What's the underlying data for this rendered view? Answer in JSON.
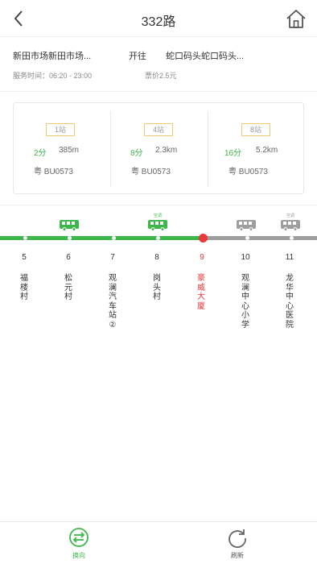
{
  "header": {
    "title": "332路"
  },
  "route": {
    "from": "新田市场新田市场...",
    "direction": "开往",
    "to": "蛇口码头蛇口码头...",
    "service_time": "服务时间：06:20 - 23:00",
    "fare": "票价2.5元"
  },
  "eta": [
    {
      "stops": "1站",
      "minutes": "2分",
      "distance": "385m",
      "plate": "粤 BU0573"
    },
    {
      "stops": "4站",
      "minutes": "8分",
      "distance": "2.3km",
      "plate": "粤 BU0573"
    },
    {
      "stops": "8站",
      "minutes": "16分",
      "distance": "5.2km",
      "plate": "粤 BU0573"
    }
  ],
  "stations": [
    {
      "num": "5",
      "name": "福楼村"
    },
    {
      "num": "6",
      "name": "松元村"
    },
    {
      "num": "7",
      "name": "观澜汽车站②"
    },
    {
      "num": "8",
      "name": "岗头村"
    },
    {
      "num": "9",
      "name": "豪威大厦"
    },
    {
      "num": "10",
      "name": "观澜中心小学"
    },
    {
      "num": "11",
      "name": "龙华中心医院"
    }
  ],
  "bus_labels": {
    "green": "空调",
    "gray": "空调"
  },
  "colors": {
    "accent": "#3db64a",
    "current": "#e9393b",
    "inactive": "#9e9e9e",
    "badge_border": "#f0c872"
  },
  "tabs": [
    {
      "label": "换向",
      "icon": "switch-direction-icon"
    },
    {
      "label": "刷新",
      "icon": "refresh-icon"
    }
  ]
}
